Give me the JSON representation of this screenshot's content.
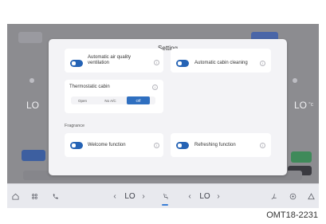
{
  "dialog": {
    "title": "Setting",
    "cards": [
      {
        "label": "Automatic air quality ventilation",
        "enabled": true
      },
      {
        "label": "Automatic cabin cleaning",
        "enabled": true
      }
    ],
    "thermostatic": {
      "label": "Thermostatic cabin",
      "options": [
        "Open",
        "No A/C",
        "Off"
      ],
      "selected": "Off"
    },
    "fragrance": {
      "section_label": "Fragrance",
      "cards": [
        {
          "label": "Welcome function",
          "enabled": true
        },
        {
          "label": "Refreshing function",
          "enabled": true
        }
      ]
    },
    "info_symbol": "i"
  },
  "background": {
    "left_temp": "LO",
    "right_temp": "LO",
    "right_unit": "°c"
  },
  "bottom_bar": {
    "left_temp": "LO",
    "right_temp": "LO",
    "left_arrow": "‹",
    "right_arrow": "›",
    "icons": [
      "home-icon",
      "apps-icon",
      "phone-icon",
      "seat-icon",
      "seat-heat-icon",
      "fan-icon",
      "alert-icon"
    ]
  },
  "caption": "OMT18-2231",
  "colors": {
    "accent": "#2563b5",
    "dialog_bg": "#f3f3f6",
    "screen_bg": "#8c8c90"
  }
}
